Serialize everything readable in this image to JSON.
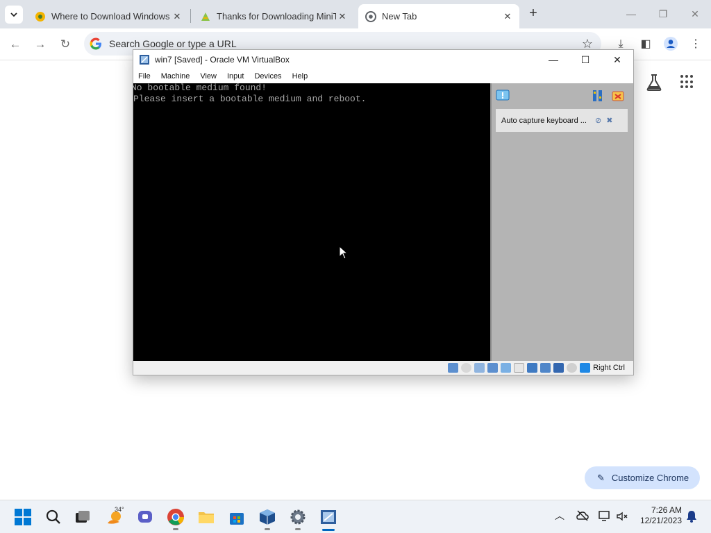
{
  "browser": {
    "tabs": [
      {
        "title": "Where to Download Windows",
        "active": false
      },
      {
        "title": "Thanks for Downloading MiniTo",
        "active": false
      },
      {
        "title": "New Tab",
        "active": true
      }
    ],
    "omnibox_placeholder": "Search Google or type a URL",
    "customize_label": "Customize Chrome"
  },
  "vbox": {
    "title": "win7 [Saved] - Oracle VM VirtualBox",
    "menu": [
      "File",
      "Machine",
      "View",
      "Input",
      "Devices",
      "Help"
    ],
    "screen_lines": [
      "No bootable medium found!",
      "Please insert a bootable medium and reboot."
    ],
    "notification": "Auto capture keyboard ...",
    "host_key": "Right Ctrl"
  },
  "taskbar": {
    "weather_temp": "34°",
    "time": "7:26 AM",
    "date": "12/21/2023"
  }
}
